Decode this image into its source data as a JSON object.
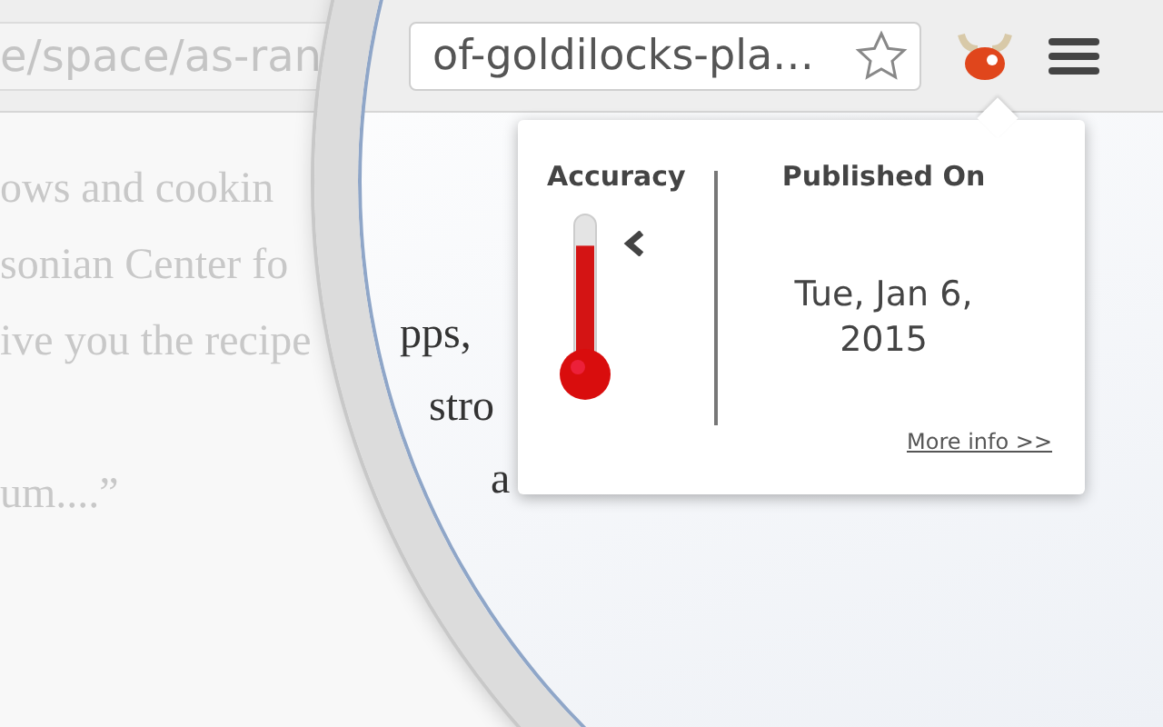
{
  "browser": {
    "url_faded": "e/space/as-ran",
    "url_magnified": "of-goldilocks-pla…"
  },
  "article": {
    "lines_faded": [
      "ows and cookin",
      "sonian Center fo",
      "ive you the recipe",
      "um....”"
    ],
    "lines_magnified": [
      "pps,",
      "stro",
      "a"
    ]
  },
  "popup": {
    "accuracy": {
      "label": "Accuracy",
      "level": 0.8
    },
    "published": {
      "label": "Published On",
      "date": "Tue, Jan 6, 2015"
    },
    "link": "More info >>"
  }
}
